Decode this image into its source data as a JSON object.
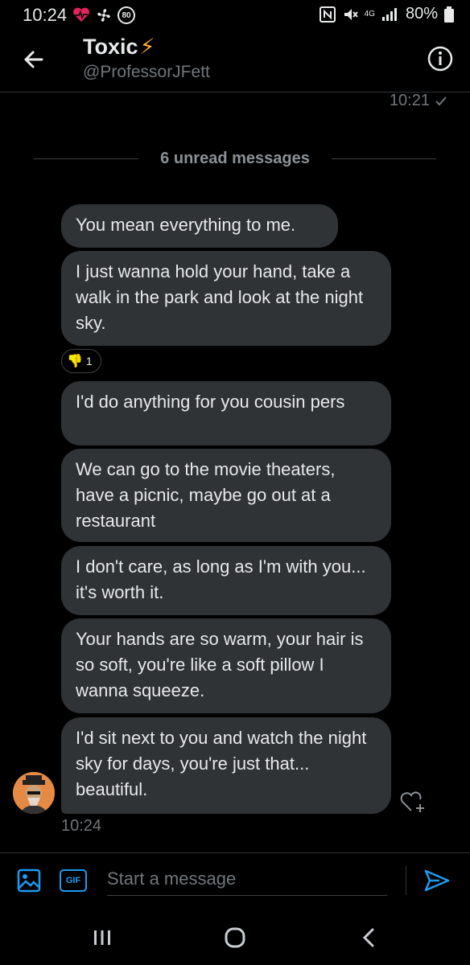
{
  "status_bar": {
    "time": "10:24",
    "notification_badge": "80",
    "network": "4G",
    "battery": "80%"
  },
  "header": {
    "name": "Toxic",
    "emoji": "⚡",
    "handle": "@ProfessorJFett"
  },
  "conversation": {
    "previous_time": "10:21",
    "unread_divider": "6 unread messages",
    "messages": [
      {
        "text": "You mean everything to me."
      },
      {
        "text": "I just wanna hold your hand, take a walk in the park and look at the night sky."
      },
      {
        "text": "I'd do anything for you cousin pers"
      },
      {
        "text": "We can go to the movie theaters, have a picnic, maybe go out at a restaurant"
      },
      {
        "text": "I don't care, as long as I'm with you... it's worth it."
      },
      {
        "text": "Your hands are so warm, your hair is so soft, you're like a soft pillow I wanna squeeze."
      },
      {
        "text": "I'd sit next to you and watch the night sky for days, you're just that... beautiful."
      }
    ],
    "reaction": {
      "emoji": "👎",
      "count": "1"
    },
    "last_time": "10:24"
  },
  "composer": {
    "gif_label": "GIF",
    "placeholder": "Start a message"
  },
  "icons": {
    "back": "arrow-left-icon",
    "info": "info-icon",
    "image": "image-icon",
    "send": "send-icon",
    "heart": "heart-plus-icon"
  },
  "colors": {
    "background": "#000000",
    "bubble": "#2f3336",
    "accent": "#1d9bf0",
    "muted": "#71767b",
    "emoji_bolt": "#ffac33"
  }
}
